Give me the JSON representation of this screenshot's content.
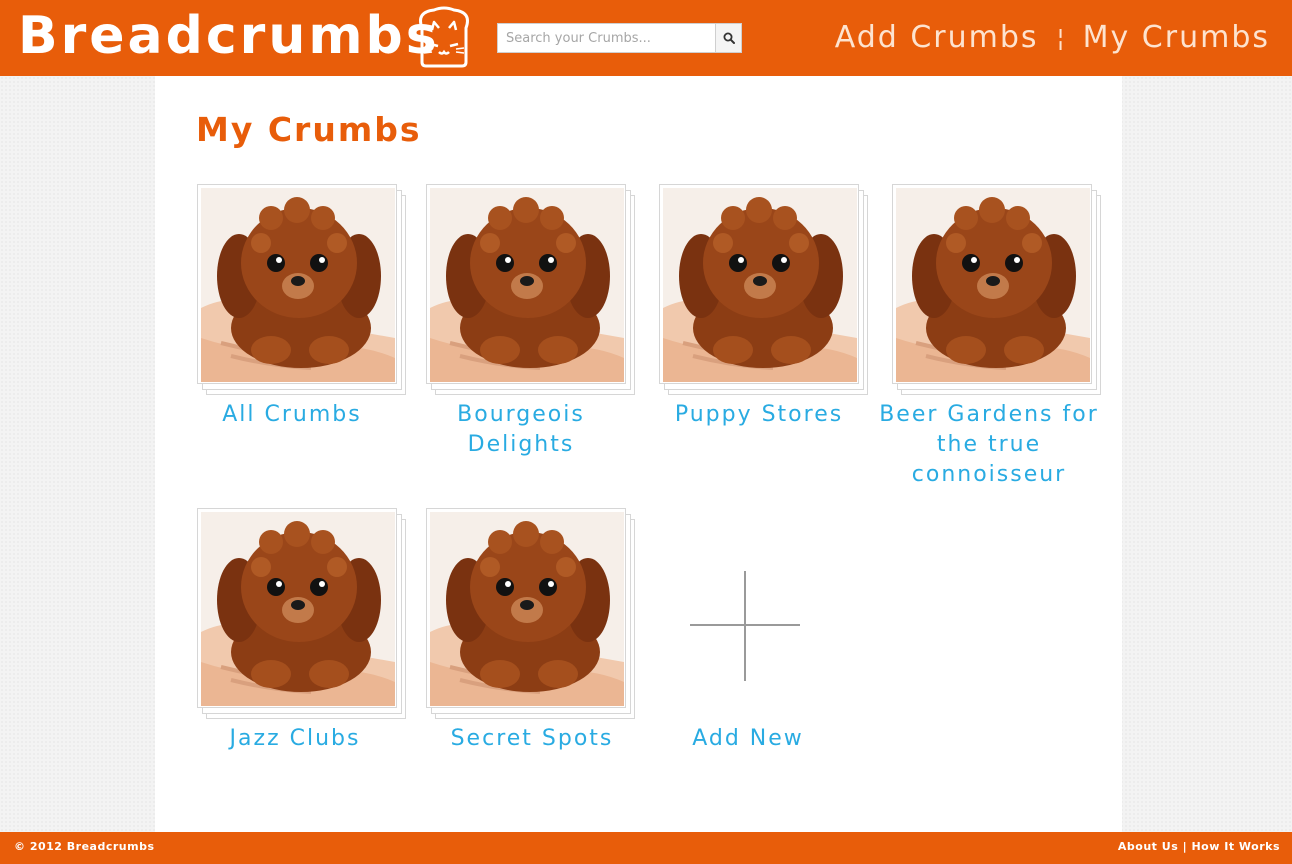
{
  "header": {
    "logo_text": "Breadcrumbs",
    "logo_icon": "toast-cat-icon",
    "search": {
      "placeholder": "Search your Crumbs...",
      "value": "",
      "button_icon": "search-icon"
    },
    "nav": {
      "add_crumbs": "Add Crumbs",
      "separator": "¦",
      "my_crumbs": "My Crumbs"
    }
  },
  "main": {
    "title": "My Crumbs",
    "collections": [
      {
        "label": "All Crumbs"
      },
      {
        "label": "Bourgeois Delights"
      },
      {
        "label": "Puppy Stores"
      },
      {
        "label": "Beer Gardens for the true connoisseur"
      },
      {
        "label": "Jazz Clubs"
      },
      {
        "label": "Secret Spots"
      }
    ],
    "add_new": {
      "label": "Add New",
      "icon": "plus-icon"
    }
  },
  "footer": {
    "copyright": "© 2012 Breadcrumbs",
    "about": "About Us",
    "separator": "|",
    "how_it_works": "How It Works"
  },
  "colors": {
    "brand_orange": "#e85d0a",
    "link_blue": "#29abe2"
  }
}
